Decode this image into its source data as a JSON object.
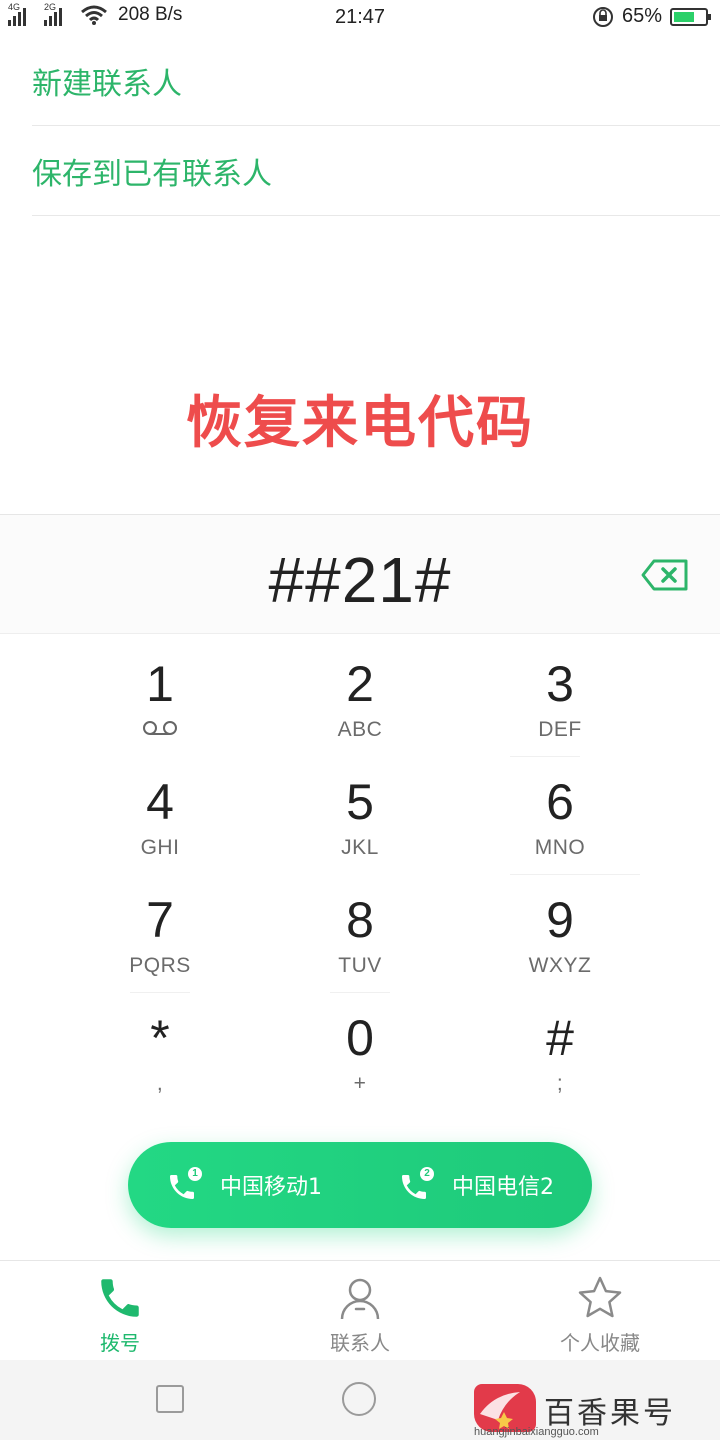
{
  "status_bar": {
    "network_1": "4G",
    "network_2": "2G",
    "net_speed": "208 B/s",
    "time": "21:47",
    "battery_pct": "65%",
    "battery_level": 0.65
  },
  "menu": {
    "new_contact": "新建联系人",
    "save_existing": "保存到已有联系人"
  },
  "overlay_title": "恢复来电代码",
  "dialer": {
    "number": "##21#",
    "keys": [
      {
        "digit": "1",
        "letters": ""
      },
      {
        "digit": "2",
        "letters": "ABC"
      },
      {
        "digit": "3",
        "letters": "DEF"
      },
      {
        "digit": "4",
        "letters": "GHI"
      },
      {
        "digit": "5",
        "letters": "JKL"
      },
      {
        "digit": "6",
        "letters": "MNO"
      },
      {
        "digit": "7",
        "letters": "PQRS"
      },
      {
        "digit": "8",
        "letters": "TUV"
      },
      {
        "digit": "9",
        "letters": "WXYZ"
      },
      {
        "digit": "*",
        "letters": ","
      },
      {
        "digit": "0",
        "letters": "+"
      },
      {
        "digit": "#",
        "letters": ";"
      }
    ]
  },
  "call": {
    "sim1": {
      "badge": "1",
      "label": "中国移动1"
    },
    "sim2": {
      "badge": "2",
      "label": "中国电信2"
    }
  },
  "tabs": {
    "dial": "拨号",
    "contacts": "联系人",
    "favorites": "个人收藏"
  },
  "watermark": {
    "text": "百香果号",
    "url": "huangjinbaixiangguo.com"
  },
  "colors": {
    "accent": "#2db56a",
    "call_button": "#23d884",
    "overlay_red": "#ee4c4c"
  }
}
